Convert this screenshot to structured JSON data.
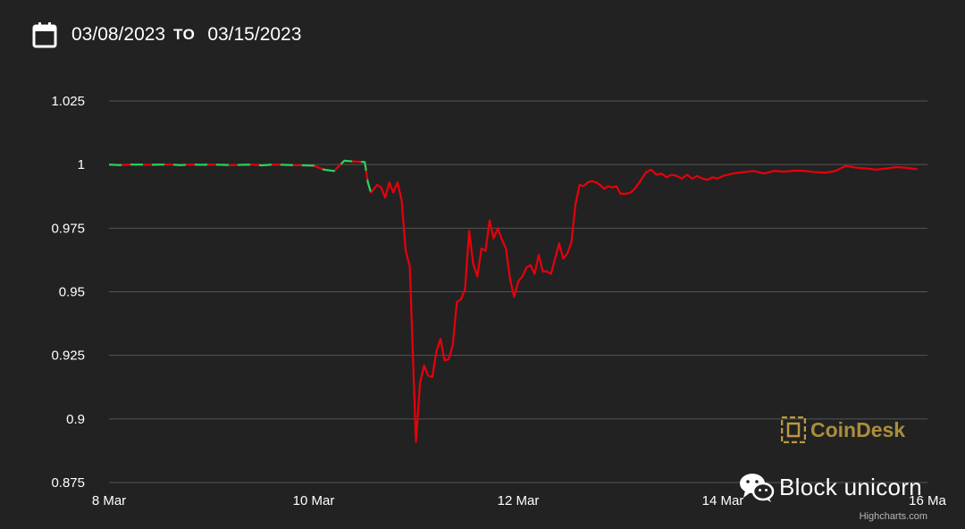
{
  "date_range": {
    "from": "03/08/2023",
    "separator": "TO",
    "to": "03/15/2023",
    "icon": "calendar-icon"
  },
  "chart_data": {
    "type": "line",
    "title": "",
    "xlabel": "",
    "ylabel": "",
    "x_unit": "days since 8 Mar",
    "xlim": [
      0,
      8
    ],
    "ylim": [
      0.875,
      1.025
    ],
    "yticks": [
      0.875,
      0.9,
      0.925,
      0.95,
      0.975,
      1
    ],
    "ytick_labels": [
      "0.875",
      "0.9",
      "0.925",
      "0.95",
      "0.975",
      "1",
      "1.025"
    ],
    "xticks": [
      0,
      2,
      4,
      6,
      8
    ],
    "xtick_labels": [
      "8 Mar",
      "10 Mar",
      "12 Mar",
      "14 Mar",
      "16 Ma"
    ],
    "grid": true,
    "colors": {
      "up": "#1ed760",
      "down": "#e8000c",
      "grid": "#555555"
    },
    "series": [
      {
        "name": "",
        "x": [
          0.0,
          0.1,
          0.2,
          0.3,
          0.4,
          0.5,
          0.6,
          0.7,
          0.8,
          0.9,
          1.0,
          1.1,
          1.2,
          1.3,
          1.4,
          1.5,
          1.6,
          1.7,
          1.8,
          1.9,
          2.0,
          2.1,
          2.2,
          2.3,
          2.4,
          2.5,
          2.53,
          2.56,
          2.62,
          2.66,
          2.7,
          2.74,
          2.78,
          2.82,
          2.86,
          2.9,
          2.94,
          3.0,
          3.04,
          3.08,
          3.12,
          3.16,
          3.2,
          3.24,
          3.28,
          3.32,
          3.36,
          3.4,
          3.44,
          3.48,
          3.52,
          3.56,
          3.6,
          3.64,
          3.68,
          3.72,
          3.76,
          3.8,
          3.84,
          3.88,
          3.92,
          3.96,
          4.0,
          4.04,
          4.08,
          4.12,
          4.16,
          4.2,
          4.24,
          4.28,
          4.32,
          4.36,
          4.4,
          4.44,
          4.48,
          4.52,
          4.56,
          4.6,
          4.64,
          4.68,
          4.72,
          4.76,
          4.8,
          4.84,
          4.88,
          4.92,
          4.96,
          5.0,
          5.05,
          5.1,
          5.15,
          5.2,
          5.25,
          5.3,
          5.35,
          5.4,
          5.45,
          5.5,
          5.55,
          5.6,
          5.65,
          5.7,
          5.75,
          5.8,
          5.85,
          5.9,
          5.95,
          6.0,
          6.1,
          6.2,
          6.3,
          6.4,
          6.5,
          6.6,
          6.7,
          6.8,
          6.9,
          7.0,
          7.1,
          7.2,
          7.3,
          7.4,
          7.5,
          7.6,
          7.7,
          7.8,
          7.9
        ],
        "y": [
          1.0,
          0.9998,
          1.0,
          1.0,
          0.9999,
          1.0,
          1.0,
          0.9998,
          1.0,
          0.9999,
          1.0,
          0.9999,
          0.9998,
          0.9999,
          1.0,
          0.9997,
          1.0,
          0.9999,
          0.9998,
          0.9997,
          0.9996,
          0.998,
          0.9975,
          1.0015,
          1.0012,
          1.001,
          0.993,
          0.989,
          0.992,
          0.991,
          0.987,
          0.993,
          0.989,
          0.993,
          0.986,
          0.966,
          0.96,
          0.891,
          0.914,
          0.921,
          0.917,
          0.9165,
          0.9265,
          0.9315,
          0.923,
          0.9235,
          0.929,
          0.946,
          0.947,
          0.951,
          0.974,
          0.961,
          0.956,
          0.967,
          0.966,
          0.978,
          0.971,
          0.975,
          0.9705,
          0.967,
          0.955,
          0.948,
          0.954,
          0.956,
          0.9595,
          0.9605,
          0.957,
          0.9645,
          0.958,
          0.958,
          0.957,
          0.963,
          0.969,
          0.963,
          0.965,
          0.9695,
          0.9845,
          0.992,
          0.9915,
          0.993,
          0.9935,
          0.993,
          0.992,
          0.9905,
          0.9915,
          0.991,
          0.9915,
          0.9885,
          0.9885,
          0.989,
          0.991,
          0.994,
          0.997,
          0.998,
          0.996,
          0.9965,
          0.995,
          0.996,
          0.9955,
          0.9945,
          0.996,
          0.9945,
          0.9955,
          0.9945,
          0.994,
          0.995,
          0.9945,
          0.9955,
          0.9965,
          0.997,
          0.9975,
          0.9965,
          0.9975,
          0.9972,
          0.9976,
          0.9975,
          0.997,
          0.9968,
          0.9975,
          0.9995,
          0.9988,
          0.9985,
          0.998,
          0.9985,
          0.999,
          0.9987,
          0.9982
        ]
      }
    ],
    "up_until_x": 2.6
  },
  "branding": {
    "logo_text": "CoinDesk",
    "logo_icon": "coindesk-logo-icon",
    "watermark_text": "Block unicorn",
    "watermark_icon": "wechat-icon",
    "credits": "Highcharts.com"
  }
}
